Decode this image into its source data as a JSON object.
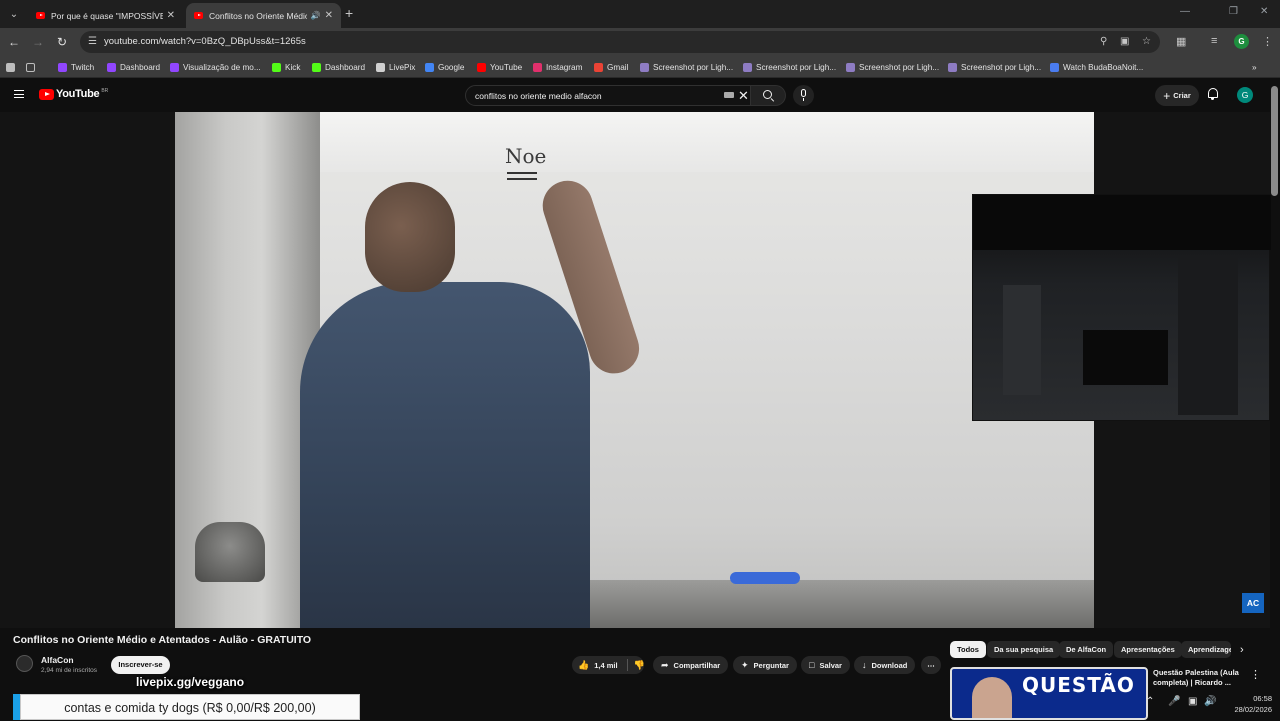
{
  "browser": {
    "tabs": [
      {
        "title": "Por que é quase \"IMPOSSÍVEL\"",
        "active": false
      },
      {
        "title": "Conflitos no Oriente Médio",
        "active": true
      }
    ],
    "address": "youtube.com/watch?v=0BzQ_DBpUss&t=1265s",
    "bookmarks": [
      {
        "label": "Twitch",
        "icon": "twitch-icon",
        "color": "#9146ff"
      },
      {
        "label": "Dashboard",
        "icon": "twitch-icon",
        "color": "#9146ff"
      },
      {
        "label": "Visualização de mo...",
        "icon": "twitch-icon",
        "color": "#9146ff"
      },
      {
        "label": "Kick",
        "icon": "kick-icon",
        "color": "#53fc18"
      },
      {
        "label": "Dashboard",
        "icon": "kick-icon",
        "color": "#53fc18"
      },
      {
        "label": "LivePix",
        "icon": "livepix-icon",
        "color": "#d0d0d0"
      },
      {
        "label": "Google",
        "icon": "google-icon",
        "color": "#4285f4"
      },
      {
        "label": "YouTube",
        "icon": "youtube-icon",
        "color": "#ff0000"
      },
      {
        "label": "Instagram",
        "icon": "instagram-icon",
        "color": "#e1306c"
      },
      {
        "label": "Gmail",
        "icon": "gmail-icon",
        "color": "#ea4335"
      },
      {
        "label": "Screenshot por Ligh...",
        "icon": "lightshot-icon",
        "color": "#8e7cc3"
      },
      {
        "label": "Screenshot por Ligh...",
        "icon": "lightshot-icon",
        "color": "#8e7cc3"
      },
      {
        "label": "Screenshot por Ligh...",
        "icon": "lightshot-icon",
        "color": "#8e7cc3"
      },
      {
        "label": "Screenshot por Ligh...",
        "icon": "lightshot-icon",
        "color": "#8e7cc3"
      },
      {
        "label": "Watch BudaBoaNoit...",
        "icon": "watch-icon",
        "color": "#4a7cf0"
      }
    ],
    "profile_initial": "G"
  },
  "youtube": {
    "logo": "YouTube",
    "logo_country": "BR",
    "search_value": "conflitos no oriente medio alfacon",
    "create_label": "Criar",
    "avatar_initial": "G",
    "video": {
      "board_text": "Noe",
      "channel_logo": "AC"
    },
    "title": "Conflitos no Oriente Médio e Atentados - Aulão - GRATUITO",
    "channel": {
      "name": "AlfaCon",
      "subscribers": "2,94 mi de inscritos",
      "subscribe_label": "Inscrever-se"
    },
    "actions": {
      "likes": "1,4 mil",
      "share": "Compartilhar",
      "ask": "Perguntar",
      "save": "Salvar",
      "download": "Download"
    },
    "chips": [
      "Todos",
      "Da sua pesquisa",
      "De AlfaCon",
      "Apresentações",
      "Aprendizagem"
    ],
    "recommendation": {
      "thumb_text": "QUESTÃO",
      "title": "Questão Palestina (Aula completa) | Ricardo ..."
    }
  },
  "overlay": {
    "livepix": "livepix.gg/veggano",
    "goal": "contas e comida ty dogs (R$ 0,00/R$ 200,00)",
    "goal_progress": 0
  },
  "taskbar": {
    "time": "06:58",
    "date": "28/02/2026"
  }
}
